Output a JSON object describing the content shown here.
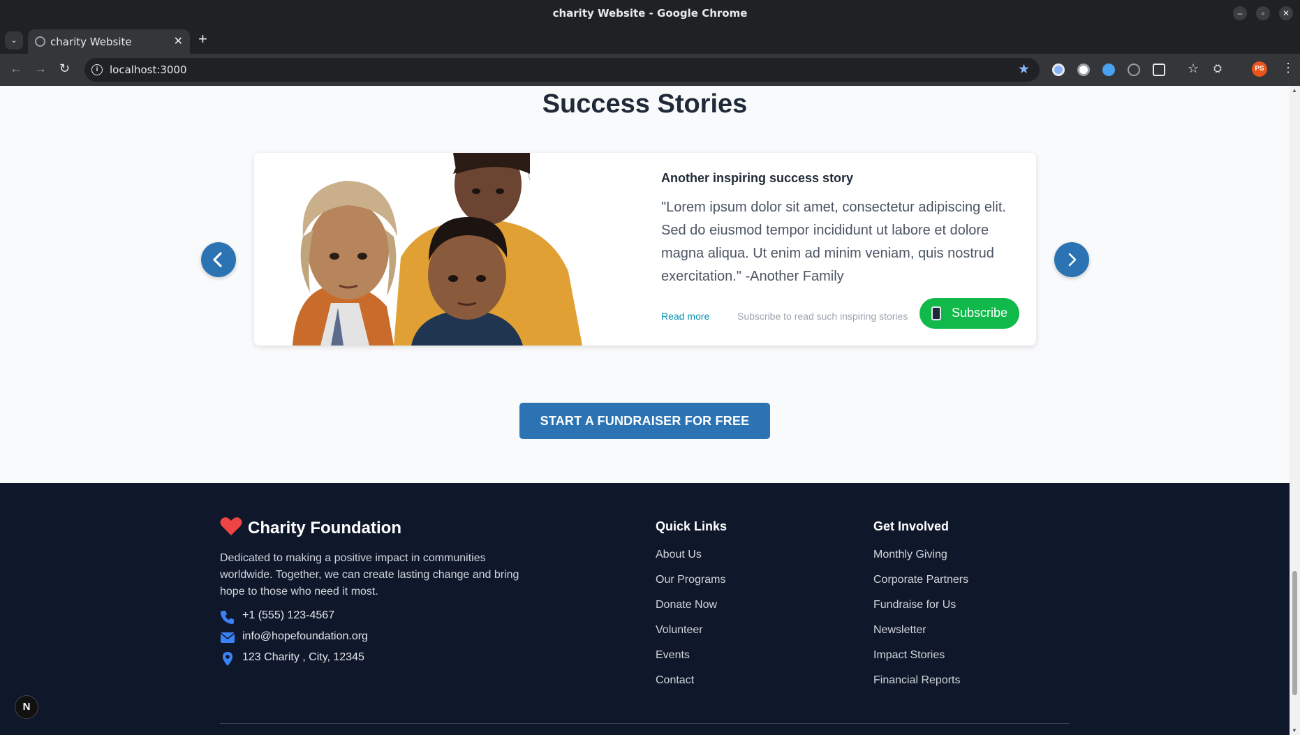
{
  "window": {
    "title": "charity Website - Google Chrome"
  },
  "tab": {
    "label": "charity Website"
  },
  "toolbar": {
    "url": "localhost:3000",
    "profile_initials": "PS"
  },
  "section": {
    "title": "Success Stories"
  },
  "story": {
    "title": "Another inspiring success story",
    "quote": "\"Lorem ipsum dolor sit amet, consectetur adipiscing elit. Sed do eiusmod tempor incididunt ut labore et dolore magna aliqua. Ut enim ad minim veniam, quis nostrud exercitation.\" -Another Family",
    "read_more": "Read more",
    "subscribe_note": "Subscribe to read such inspiring stories",
    "subscribe_label": "Subscribe"
  },
  "cta": {
    "label": "START A FUNDRAISER FOR FREE"
  },
  "footer": {
    "brand": "Charity Foundation",
    "mission": "Dedicated to making a positive impact in communities worldwide. Together, we can create lasting change and bring hope to those who need it most.",
    "phone": "+1 (555) 123-4567",
    "email": "info@hopefoundation.org",
    "address": "123 Charity , City, 12345",
    "quick_links_title": "Quick Links",
    "quick_links": [
      "About Us",
      "Our Programs",
      "Donate Now",
      "Volunteer",
      "Events",
      "Contact"
    ],
    "get_involved_title": "Get Involved",
    "get_involved": [
      "Monthly Giving",
      "Corporate Partners",
      "Fundraise for Us",
      "Newsletter",
      "Impact Stories",
      "Financial Reports"
    ]
  },
  "colors": {
    "primary": "#2b73b3",
    "subscribe": "#10b94a",
    "footer_bg": "#0f172a",
    "accent_link": "#0891b2",
    "heart": "#ef4444"
  },
  "dev_badge": "N"
}
